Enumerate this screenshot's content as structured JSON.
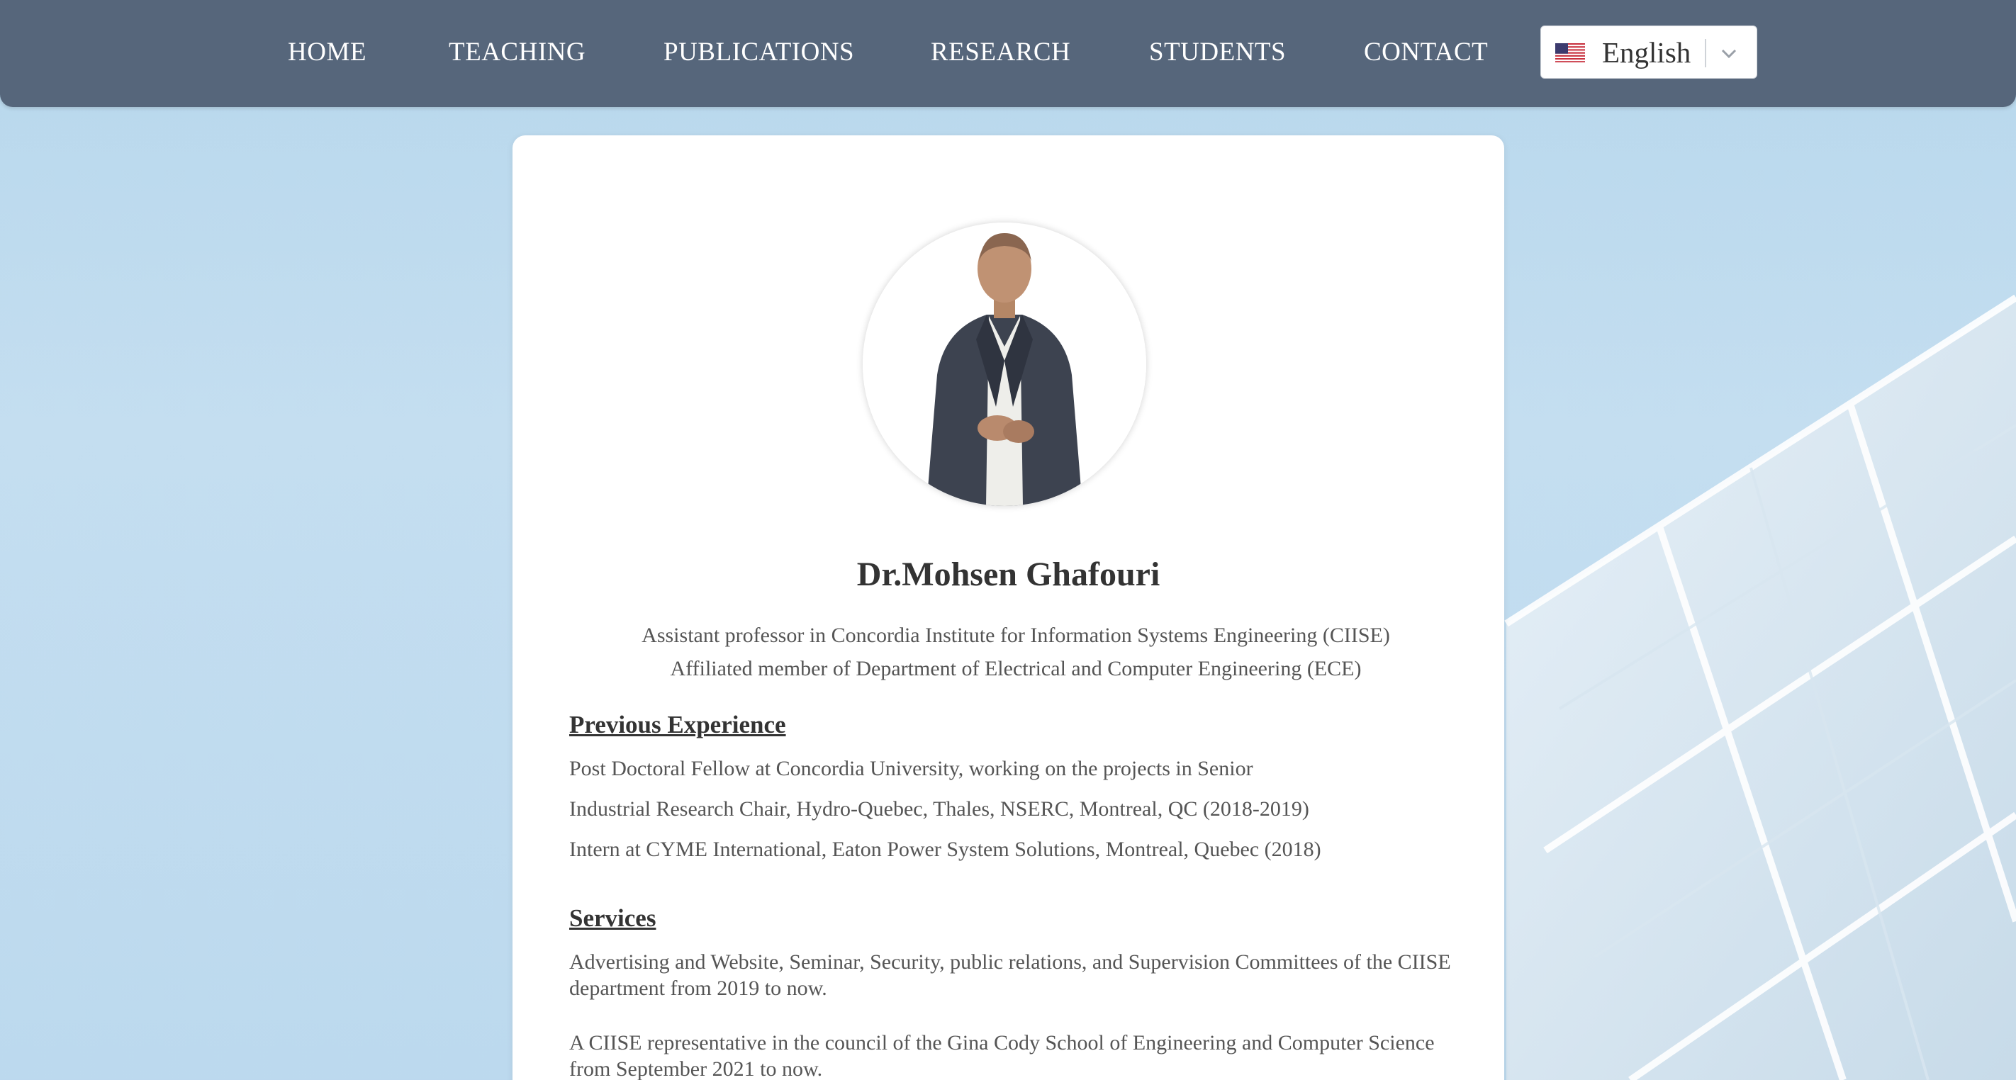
{
  "nav": {
    "items": [
      {
        "label": "HOME"
      },
      {
        "label": "TEACHING"
      },
      {
        "label": "PUBLICATIONS"
      },
      {
        "label": "RESEARCH"
      },
      {
        "label": "STUDENTS"
      },
      {
        "label": "CONTACT"
      }
    ],
    "language": {
      "selected": "English",
      "flag_icon": "us-flag-icon"
    }
  },
  "profile": {
    "name": "Dr.Mohsen Ghafouri",
    "subtitle_lines": [
      "Assistant professor in Concordia Institute for Information Systems Engineering (CIISE)",
      "Affiliated member of Department of Electrical and Computer Engineering (ECE)"
    ]
  },
  "previous_experience": {
    "title": "Previous Experience",
    "lines": [
      "Post Doctoral Fellow at Concordia University, working on the projects in Senior",
      "Industrial Research Chair, Hydro-Quebec, Thales, NSERC, Montreal, QC (2018-2019)",
      "Intern at CYME International, Eaton Power System Solutions, Montreal, Quebec (2018)"
    ]
  },
  "services": {
    "title": "Services",
    "paragraphs": [
      "Advertising and Website, Seminar, Security, public relations, and Supervision Committees of the CIISE department from 2019 to now.",
      "A CIISE representative in the council of the Gina Cody School of Engineering and Computer Science from September 2021 to now."
    ]
  },
  "colors": {
    "navbar": "#56667b",
    "background": "#b7d7ec",
    "card": "#ffffff",
    "text": "#555555",
    "heading": "#333333"
  }
}
